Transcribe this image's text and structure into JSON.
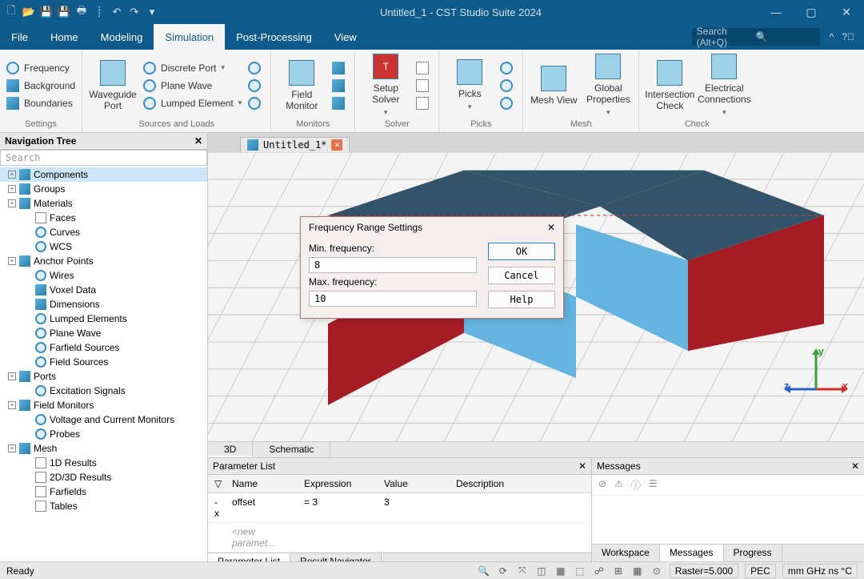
{
  "titlebar": {
    "title": "Untitled_1 - CST Studio Suite 2024"
  },
  "menubar": {
    "tabs": [
      "File",
      "Home",
      "Modeling",
      "Simulation",
      "Post-Processing",
      "View"
    ],
    "active_index": 3,
    "search_placeholder": "Search (Alt+Q)"
  },
  "ribbon": {
    "settings": {
      "label": "Settings",
      "items": [
        "Frequency",
        "Background",
        "Boundaries"
      ]
    },
    "sources": {
      "label": "Sources and Loads",
      "waveguide": "Waveguide Port",
      "items": [
        "Discrete Port",
        "Plane Wave",
        "Lumped Element"
      ]
    },
    "monitors": {
      "label": "Monitors",
      "field_monitor": "Field Monitor"
    },
    "solver": {
      "label": "Solver",
      "setup_solver": "Setup Solver"
    },
    "picks": {
      "label": "Picks",
      "picks": "Picks"
    },
    "mesh": {
      "label": "Mesh",
      "mesh_view": "Mesh View",
      "global_props": "Global Properties"
    },
    "check": {
      "label": "Check",
      "isect": "Intersection Check",
      "elec": "Electrical Connections"
    }
  },
  "navtree": {
    "title": "Navigation Tree",
    "search_placeholder": "Search",
    "items": [
      {
        "label": "Components",
        "expandable": true,
        "sel": true,
        "icon": "cube3"
      },
      {
        "label": "Groups",
        "expandable": true,
        "icon": "cube3"
      },
      {
        "label": "Materials",
        "expandable": true,
        "icon": "cube3"
      },
      {
        "label": "Faces",
        "icon": "sheet",
        "indent": true
      },
      {
        "label": "Curves",
        "icon": "ring",
        "indent": true
      },
      {
        "label": "WCS",
        "icon": "ring",
        "indent": true
      },
      {
        "label": "Anchor Points",
        "expandable": true,
        "icon": "cube3"
      },
      {
        "label": "Wires",
        "icon": "ring",
        "indent": true
      },
      {
        "label": "Voxel Data",
        "icon": "cube3",
        "indent": true
      },
      {
        "label": "Dimensions",
        "icon": "cube3",
        "indent": true
      },
      {
        "label": "Lumped Elements",
        "icon": "ring",
        "indent": true
      },
      {
        "label": "Plane Wave",
        "icon": "ring",
        "indent": true
      },
      {
        "label": "Farfield Sources",
        "icon": "ring",
        "indent": true
      },
      {
        "label": "Field Sources",
        "icon": "ring",
        "indent": true
      },
      {
        "label": "Ports",
        "expandable": true,
        "icon": "cube3"
      },
      {
        "label": "Excitation Signals",
        "icon": "ring",
        "indent": true
      },
      {
        "label": "Field Monitors",
        "expandable": true,
        "icon": "cube3"
      },
      {
        "label": "Voltage and Current Monitors",
        "icon": "ring",
        "indent": true
      },
      {
        "label": "Probes",
        "icon": "ring",
        "indent": true
      },
      {
        "label": "Mesh",
        "expandable": true,
        "icon": "cube3"
      },
      {
        "label": "1D Results",
        "icon": "sheet",
        "indent": true
      },
      {
        "label": "2D/3D Results",
        "icon": "sheet",
        "indent": true
      },
      {
        "label": "Farfields",
        "icon": "sheet",
        "indent": true
      },
      {
        "label": "Tables",
        "icon": "sheet",
        "indent": true
      }
    ]
  },
  "doc": {
    "tab_label": "Untitled_1*"
  },
  "viewtabs": [
    "3D",
    "Schematic"
  ],
  "paramlist": {
    "title": "Parameter List",
    "headers": [
      "",
      "Name",
      "Expression",
      "Value",
      "Description"
    ],
    "rows": [
      {
        "pin": "-x",
        "name": "offset",
        "expression": "= 3",
        "value": "3",
        "description": ""
      }
    ],
    "new_row_placeholder": "<new paramet..."
  },
  "paramlist_tabs": [
    "Parameter List",
    "Result Navigator"
  ],
  "messages": {
    "title": "Messages"
  },
  "messages_tabs": [
    "Workspace",
    "Messages",
    "Progress"
  ],
  "statusbar": {
    "ready": "Ready",
    "raster": "Raster=5.000",
    "pec": "PEC",
    "units": "mm GHz ns °C"
  },
  "dialog": {
    "title": "Frequency Range Settings",
    "min_label": "Min. frequency:",
    "min_value": "8",
    "max_label": "Max. frequency:",
    "max_value": "10",
    "ok": "OK",
    "cancel": "Cancel",
    "help": "Help"
  }
}
